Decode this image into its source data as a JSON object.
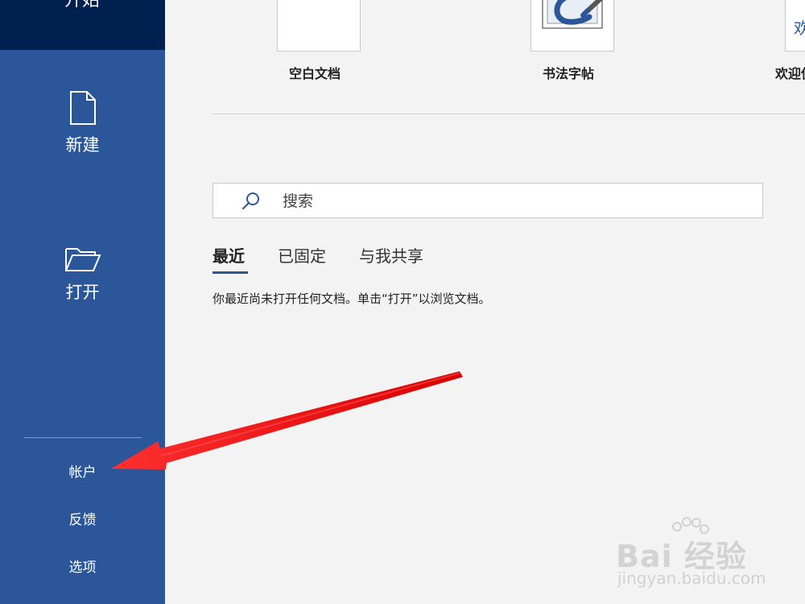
{
  "sidebar": {
    "top_label": "开始",
    "new_label": "新建",
    "open_label": "打开",
    "account_label": "帐户",
    "feedback_label": "反馈",
    "options_label": "选项"
  },
  "templates": [
    {
      "name": "空白文档"
    },
    {
      "name": "书法字帖"
    },
    {
      "name": "欢迎使",
      "thumb_text": "欢"
    }
  ],
  "search": {
    "placeholder": "搜索"
  },
  "tabs": [
    {
      "label": "最近",
      "active": true
    },
    {
      "label": "已固定",
      "active": false
    },
    {
      "label": "与我共享",
      "active": false
    }
  ],
  "recent": {
    "empty_message": "你最近尚未打开任何文档。单击“打开”以浏览文档。"
  },
  "watermark": {
    "brand_text": "Bai 经验",
    "url": "jingyan.baidu.com"
  },
  "colors": {
    "sidebar": "#2b579a",
    "sidebar_top": "#002050",
    "arrow": "#e81c1c",
    "background": "#f3f3f3"
  }
}
